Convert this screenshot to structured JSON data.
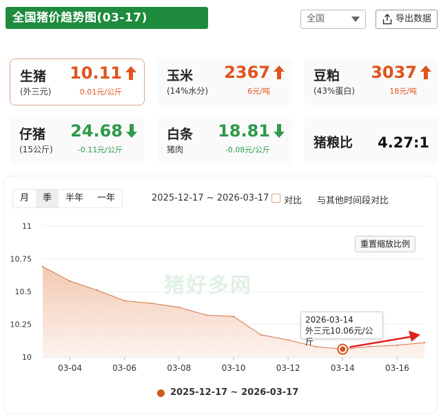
{
  "header": {
    "title": "全国猪价趋势图(03-17)",
    "region": "全国",
    "export_label": "导出数据"
  },
  "cards": [
    {
      "name": "生猪",
      "sub": "(外三元)",
      "price": "10.11",
      "change": "0.01元/公斤",
      "trend": "up"
    },
    {
      "name": "玉米",
      "sub": "(14%水分)",
      "price": "2367",
      "change": "6元/吨",
      "trend": "up"
    },
    {
      "name": "豆粕",
      "sub": "(43%蛋白)",
      "price": "3037",
      "change": "18元/吨",
      "trend": "up"
    },
    {
      "name": "仔猪",
      "sub": "(15公斤)",
      "price": "24.68",
      "change": "-0.11元/公斤",
      "trend": "down"
    },
    {
      "name": "白条",
      "sub": "猪肉",
      "price": "18.81",
      "change": "-0.08元/公斤",
      "trend": "down"
    },
    {
      "name": "猪粮比",
      "value": "4.27:1"
    }
  ],
  "chart_panel": {
    "tabs": [
      "月",
      "季",
      "半年",
      "一年"
    ],
    "active_tab": "季",
    "date_range": "2025-12-17 ~ 2026-03-17",
    "compare_label": "对比",
    "compare_desc": "与其他时间段对比",
    "reset_label": "重置缩放比例",
    "watermark": "猪好多网",
    "tooltip": {
      "date": "2026-03-14",
      "text": "外三元10.06元/公斤"
    },
    "legend_label": "2025-12-17 ~ 2026-03-17"
  },
  "chart_data": {
    "type": "area",
    "ylim": [
      10,
      11
    ],
    "yticks": [
      "11",
      "10.75",
      "10.5",
      "10.25",
      "10"
    ],
    "ytick_values": [
      11,
      10.75,
      10.5,
      10.25,
      10
    ],
    "xticks": [
      "03-04",
      "03-06",
      "03-08",
      "03-10",
      "03-12",
      "03-14",
      "03-16"
    ],
    "xlim": [
      "03-03",
      "03-17"
    ],
    "series": [
      {
        "name": "2025-12-17 ~ 2026-03-17",
        "color": "#d2571c",
        "x": [
          "03-03",
          "03-04",
          "03-05",
          "03-06",
          "03-07",
          "03-08",
          "03-09",
          "03-10",
          "03-11",
          "03-12",
          "03-13",
          "03-14",
          "03-15",
          "03-16",
          "03-17"
        ],
        "values": [
          10.69,
          10.58,
          10.51,
          10.43,
          10.41,
          10.38,
          10.32,
          10.31,
          10.17,
          10.13,
          10.08,
          10.06,
          10.08,
          10.09,
          10.11
        ]
      }
    ],
    "highlight": {
      "x": "03-14",
      "value": 10.06
    }
  }
}
